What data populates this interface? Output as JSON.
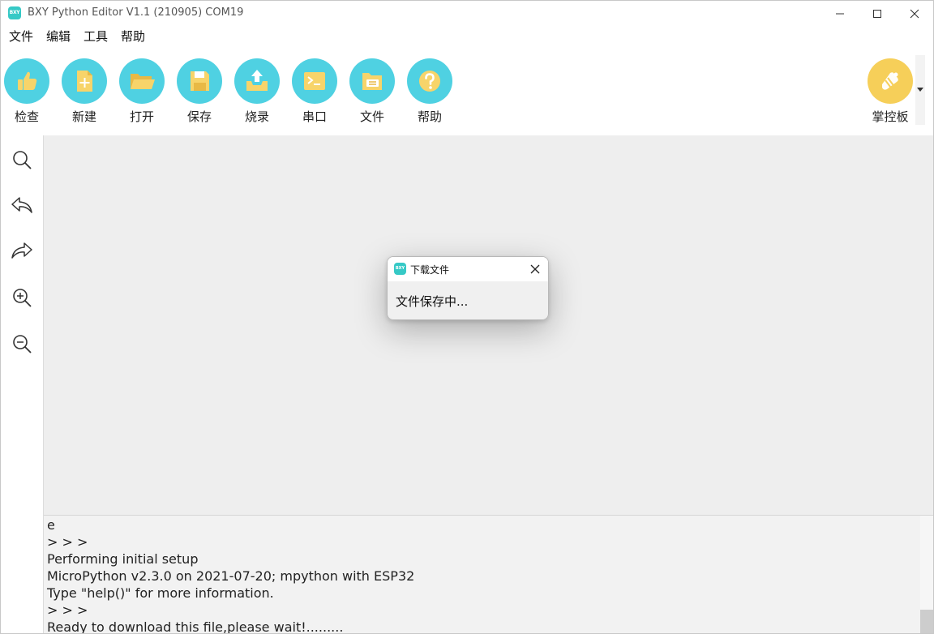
{
  "window": {
    "logo_text": "BXY",
    "title": "BXY Python Editor V1.1 (210905) COM19"
  },
  "menu": [
    "文件",
    "编辑",
    "工具",
    "帮助"
  ],
  "toolbar": {
    "items": [
      {
        "label": "检查",
        "icon": "thumbs-up-icon"
      },
      {
        "label": "新建",
        "icon": "new-file-icon"
      },
      {
        "label": "打开",
        "icon": "open-folder-icon"
      },
      {
        "label": "保存",
        "icon": "save-disk-icon"
      },
      {
        "label": "烧录",
        "icon": "upload-tray-icon"
      },
      {
        "label": "串口",
        "icon": "terminal-icon"
      },
      {
        "label": "文件",
        "icon": "file-folder-icon"
      },
      {
        "label": "帮助",
        "icon": "help-icon"
      }
    ],
    "board_label": "掌控板"
  },
  "sidebar": [
    "search-icon",
    "undo-icon",
    "redo-icon",
    "zoom-in-icon",
    "zoom-out-icon"
  ],
  "console": {
    "lines": [
      "e",
      "> > >",
      "Performing initial setup",
      "MicroPython v2.3.0 on 2021-07-20; mpython with ESP32",
      "Type \"help()\" for more information.",
      "> > >",
      "Ready to download this file,please wait!........."
    ]
  },
  "dialog": {
    "logo_text": "BXY",
    "title": "下载文件",
    "message": "文件保存中..."
  },
  "colors": {
    "tool_icon": "#4fd1e2",
    "board_icon": "#f6cf59",
    "editor_bg": "#eeeeee",
    "logo": "#36c9c6"
  }
}
